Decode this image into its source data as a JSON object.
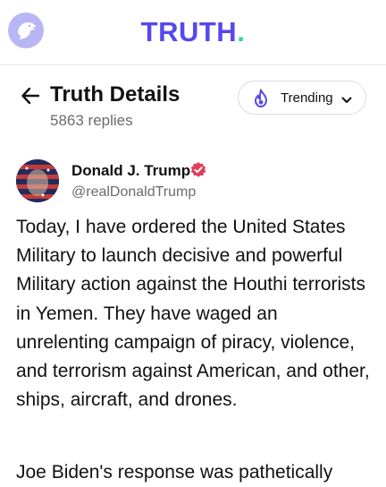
{
  "header": {
    "app_icon": "eagle-icon",
    "logo_text": "TRUTH",
    "logo_dot": ".",
    "colors": {
      "brand": "#5648ed",
      "accent": "#2fd99b",
      "icon_bg": "#b9b6f5"
    }
  },
  "detail": {
    "title": "Truth Details",
    "replies": "5863 replies",
    "back_icon": "arrow-left-icon",
    "sort": {
      "label": "Trending",
      "icon": "fire-icon",
      "dropdown_icon": "chevron-down-icon"
    }
  },
  "post": {
    "author_name": "Donald J. Trump",
    "handle": "@realDonaldTrump",
    "verified_icon": "verified-badge-icon",
    "verified_color": "#e23d5a",
    "paragraphs": [
      "Today, I have ordered the United States Military to launch decisive and powerful Military action against the Houthi terrorists in Yemen. They have waged an unrelenting campaign of piracy, violence, and terrorism against American, and other, ships, aircraft, and drones.",
      "Joe Biden's response was pathetically"
    ]
  }
}
